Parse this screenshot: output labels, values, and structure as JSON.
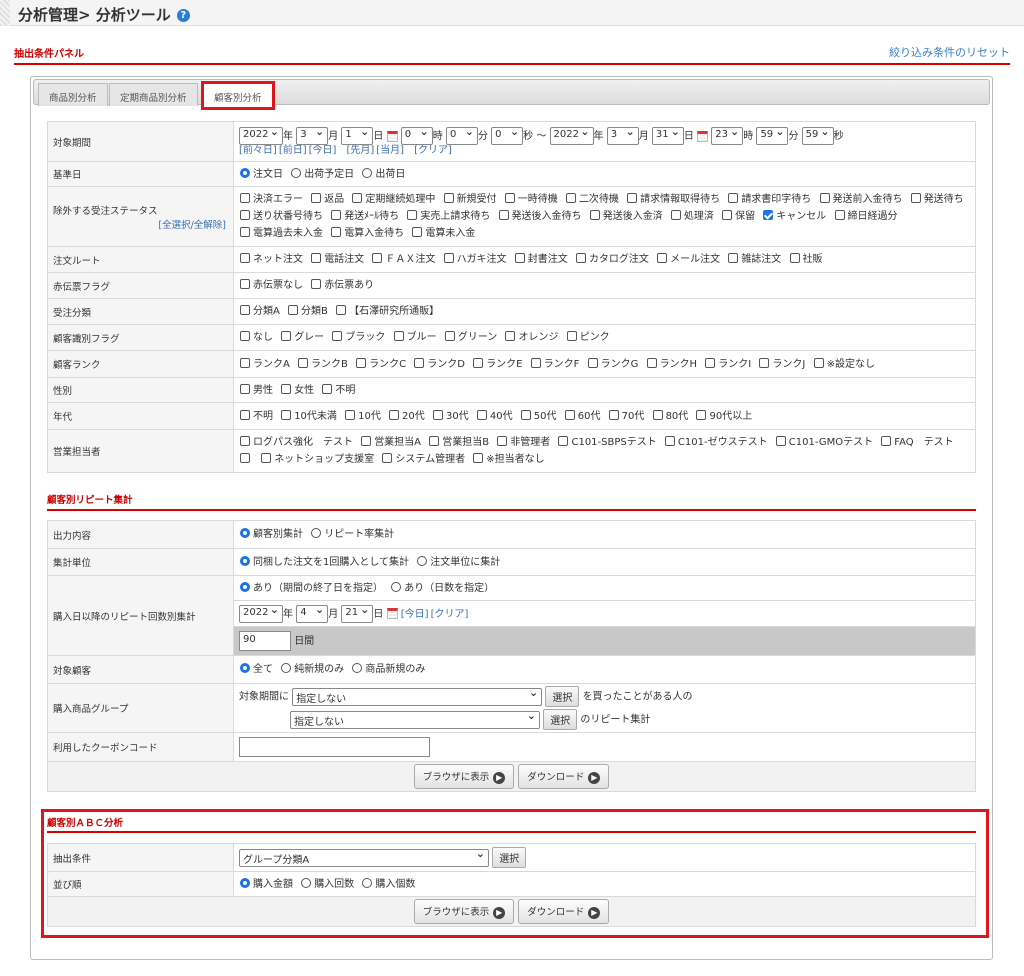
{
  "header": {
    "title": "分析管理> 分析ツール",
    "help_icon": "?"
  },
  "panel": {
    "title": "抽出条件パネル",
    "reset_link": "絞り込み条件のリセット"
  },
  "tabs": [
    {
      "label": "商品別分析"
    },
    {
      "label": "定期商品別分析"
    },
    {
      "label": "顧客別分析",
      "active": true
    }
  ],
  "conditions": {
    "period": {
      "label": "対象期間",
      "from": {
        "year": "2022",
        "month": "3",
        "day": "1",
        "hour": "0",
        "min": "0",
        "sec": "0"
      },
      "to": {
        "year": "2022",
        "month": "3",
        "day": "31",
        "hour": "23",
        "min": "59",
        "sec": "59"
      },
      "units": {
        "year": "年",
        "month": "月",
        "day": "日",
        "hour": "時",
        "min": "分",
        "sec": "秒",
        "tilde": "～"
      },
      "links": [
        "[前々日]",
        "[前日]",
        "[今日]",
        "[先月]",
        "[当月]",
        "[クリア]"
      ]
    },
    "base_date": {
      "label": "基準日",
      "options": [
        {
          "label": "注文日",
          "checked": true
        },
        {
          "label": "出荷予定日"
        },
        {
          "label": "出荷日"
        }
      ]
    },
    "exclude_status": {
      "label": "除外する受注ステータス",
      "sub_label": "[全選択/全解除]",
      "options": [
        {
          "label": "決済エラー"
        },
        {
          "label": "返品"
        },
        {
          "label": "定期継続処理中"
        },
        {
          "label": "新規受付"
        },
        {
          "label": "一時待機"
        },
        {
          "label": "二次待機"
        },
        {
          "label": "請求情報取得待ち"
        },
        {
          "label": "請求書印字待ち"
        },
        {
          "label": "発送前入金待ち"
        },
        {
          "label": "発送待ち"
        },
        {
          "label": "送り状番号待ち"
        },
        {
          "label": "発送ﾒｰﾙ待ち"
        },
        {
          "label": "実売上請求待ち"
        },
        {
          "label": "発送後入金待ち"
        },
        {
          "label": "発送後入金済"
        },
        {
          "label": "処理済"
        },
        {
          "label": "保留"
        },
        {
          "label": "キャンセル",
          "checked": true
        },
        {
          "label": "締日経過分"
        },
        {
          "label": "電算過去未入金"
        },
        {
          "label": "電算入金待ち"
        },
        {
          "label": "電算未入金"
        }
      ]
    },
    "order_route": {
      "label": "注文ルート",
      "options": [
        {
          "label": "ネット注文"
        },
        {
          "label": "電話注文"
        },
        {
          "label": "ＦＡＸ注文"
        },
        {
          "label": "ハガキ注文"
        },
        {
          "label": "封書注文"
        },
        {
          "label": "カタログ注文"
        },
        {
          "label": "メール注文"
        },
        {
          "label": "雑誌注文"
        },
        {
          "label": "社販"
        }
      ]
    },
    "red_slip": {
      "label": "赤伝票フラグ",
      "options": [
        {
          "label": "赤伝票なし"
        },
        {
          "label": "赤伝票あり"
        }
      ]
    },
    "order_class": {
      "label": "受注分類",
      "options": [
        {
          "label": "分類A"
        },
        {
          "label": "分類B"
        },
        {
          "label": "【石澤研究所通販】"
        }
      ]
    },
    "customer_flag": {
      "label": "顧客識別フラグ",
      "options": [
        {
          "label": "なし"
        },
        {
          "label": "グレー"
        },
        {
          "label": "ブラック"
        },
        {
          "label": "ブルー"
        },
        {
          "label": "グリーン"
        },
        {
          "label": "オレンジ"
        },
        {
          "label": "ピンク"
        }
      ]
    },
    "customer_rank": {
      "label": "顧客ランク",
      "options": [
        {
          "label": "ランクA"
        },
        {
          "label": "ランクB"
        },
        {
          "label": "ランクC"
        },
        {
          "label": "ランクD"
        },
        {
          "label": "ランクE"
        },
        {
          "label": "ランクF"
        },
        {
          "label": "ランクG"
        },
        {
          "label": "ランクH"
        },
        {
          "label": "ランクI"
        },
        {
          "label": "ランクJ"
        },
        {
          "label": "※設定なし"
        }
      ]
    },
    "gender": {
      "label": "性別",
      "options": [
        {
          "label": "男性"
        },
        {
          "label": "女性"
        },
        {
          "label": "不明"
        }
      ]
    },
    "age": {
      "label": "年代",
      "options": [
        {
          "label": "不明"
        },
        {
          "label": "10代未満"
        },
        {
          "label": "10代"
        },
        {
          "label": "20代"
        },
        {
          "label": "30代"
        },
        {
          "label": "40代"
        },
        {
          "label": "50代"
        },
        {
          "label": "60代"
        },
        {
          "label": "70代"
        },
        {
          "label": "80代"
        },
        {
          "label": "90代以上"
        }
      ]
    },
    "sales_rep": {
      "label": "営業担当者",
      "options": [
        {
          "label": "ログパス強化　テスト"
        },
        {
          "label": "営業担当A"
        },
        {
          "label": "営業担当B"
        },
        {
          "label": "非管理者"
        },
        {
          "label": "C101-SBPSテスト"
        },
        {
          "label": "C101-ゼウステスト"
        },
        {
          "label": "C101-GMOテスト"
        },
        {
          "label": "FAQ　テスト"
        },
        {
          "label": ""
        },
        {
          "label": "ネットショップ支援室"
        },
        {
          "label": "システム管理者"
        },
        {
          "label": "※担当者なし"
        }
      ]
    }
  },
  "repeat": {
    "title": "顧客別リピート集計",
    "output": {
      "label": "出力内容",
      "options": [
        {
          "label": "顧客別集計",
          "checked": true
        },
        {
          "label": "リピート率集計"
        }
      ]
    },
    "unit": {
      "label": "集計単位",
      "options": [
        {
          "label": "同梱した注文を1回購入として集計",
          "checked": true
        },
        {
          "label": "注文単位に集計"
        }
      ]
    },
    "after_purchase": {
      "label": "購入日以降のリピート回数別集計",
      "options": [
        {
          "label": "あり（期間の終了日を指定）",
          "checked": true
        },
        {
          "label": "あり（日数を指定）"
        }
      ],
      "date": {
        "year": "2022",
        "month": "4",
        "day": "21"
      },
      "links": [
        "[今日]",
        "[クリア]"
      ],
      "days_value": "90",
      "days_unit": "日間"
    },
    "target": {
      "label": "対象顧客",
      "options": [
        {
          "label": "全て",
          "checked": true
        },
        {
          "label": "純新規のみ"
        },
        {
          "label": "商品新規のみ"
        }
      ]
    },
    "group": {
      "label": "購入商品グループ",
      "prefix": "対象期間に",
      "select1": "指定しない",
      "select2": "指定しない",
      "select_button": "選択",
      "suffix1": "を買ったことがある人の",
      "suffix2": "のリピート集計"
    },
    "coupon": {
      "label": "利用したクーポンコード",
      "value": ""
    },
    "browser_button": "ブラウザに表示",
    "download_button": "ダウンロード"
  },
  "abc": {
    "title": "顧客別ＡＢＣ分析",
    "condition": {
      "label": "抽出条件",
      "value": "グループ分類A",
      "select_button": "選択"
    },
    "order": {
      "label": "並び順",
      "options": [
        {
          "label": "購入金額",
          "checked": true
        },
        {
          "label": "購入回数"
        },
        {
          "label": "購入個数"
        }
      ]
    },
    "browser_button": "ブラウザに表示",
    "download_button": "ダウンロード"
  },
  "colors": {
    "accent_red": "#e0141e",
    "link_blue": "#3a7fc4",
    "radio_blue": "#1a73e8"
  }
}
